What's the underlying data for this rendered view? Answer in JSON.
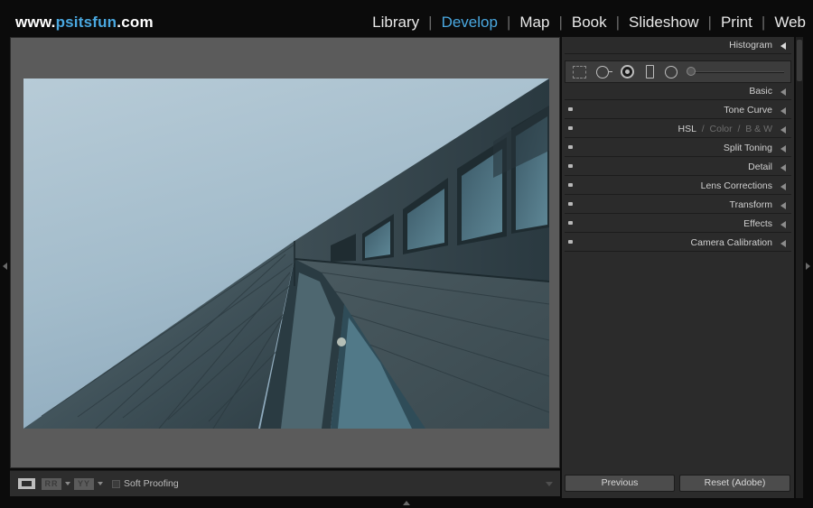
{
  "brand": {
    "prefix": "www.",
    "name": "psitsfun",
    "suffix": ".com"
  },
  "modules": [
    {
      "label": "Library",
      "active": false
    },
    {
      "label": "Develop",
      "active": true
    },
    {
      "label": "Map",
      "active": false
    },
    {
      "label": "Book",
      "active": false
    },
    {
      "label": "Slideshow",
      "active": false
    },
    {
      "label": "Print",
      "active": false
    },
    {
      "label": "Web",
      "active": false
    }
  ],
  "module_separator": "|",
  "colors": {
    "accent": "#4aa8e0",
    "panel_bg": "#2b2b2b",
    "canvas_bg": "#5b5b5b"
  },
  "photo": {
    "subject": "low-angle view of a glass and steel office building against a pale blue sky"
  },
  "toolbar": {
    "view_icon": "loupe-view-icon",
    "before_after_1": "RR",
    "before_after_2": "YY",
    "soft_proofing_label": "Soft Proofing",
    "soft_proofing_checked": false
  },
  "tools": [
    "crop-overlay-icon",
    "spot-removal-icon",
    "red-eye-icon",
    "graduated-filter-icon",
    "radial-filter-icon",
    "adjustment-brush-icon"
  ],
  "panels": {
    "histogram": "Histogram",
    "basic": "Basic",
    "tone_curve": "Tone Curve",
    "hsl": {
      "hsl": "HSL",
      "color": "Color",
      "bw": "B & W",
      "sep": "/"
    },
    "split_toning": "Split Toning",
    "detail": "Detail",
    "lens_corrections": "Lens Corrections",
    "transform": "Transform",
    "effects": "Effects",
    "camera_calibration": "Camera Calibration"
  },
  "footer": {
    "previous": "Previous",
    "reset": "Reset (Adobe)"
  }
}
